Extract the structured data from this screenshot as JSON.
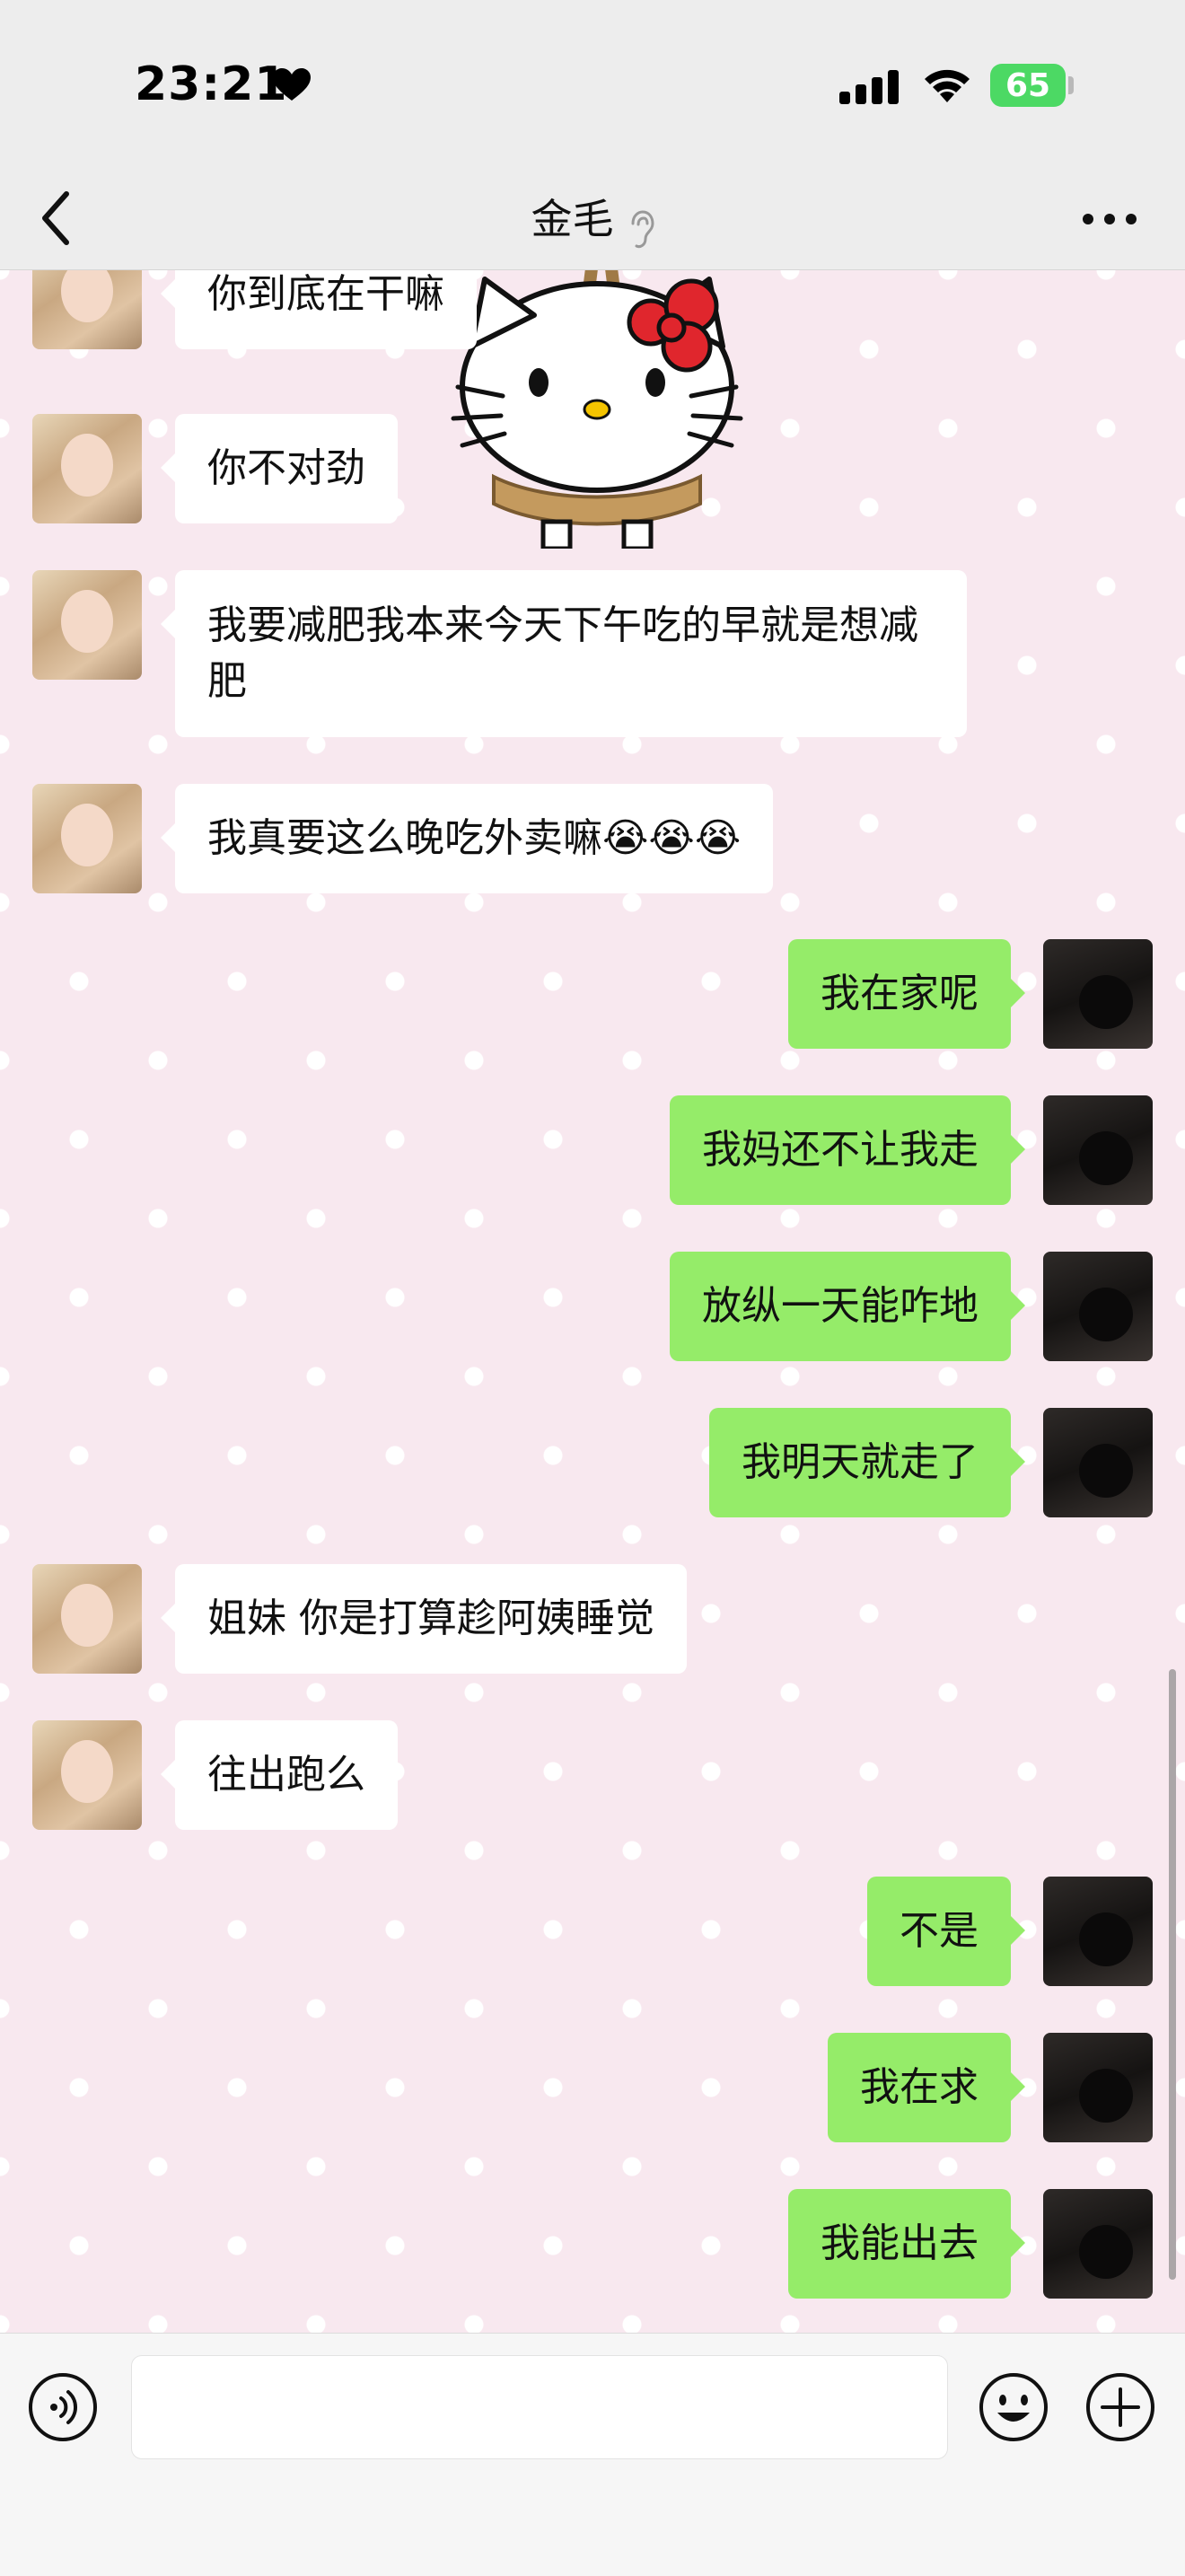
{
  "status_bar": {
    "time": "23:21",
    "battery": "65"
  },
  "header": {
    "title": "金毛"
  },
  "messages": [
    {
      "side": "left",
      "text": "你到底在干嘛"
    },
    {
      "side": "left",
      "text": "你不对劲"
    },
    {
      "side": "left",
      "text": "我要减肥我本来今天下午吃的早就是想减肥"
    },
    {
      "side": "left",
      "text": "我真要这么晚吃外卖嘛😭😭😭"
    },
    {
      "side": "right",
      "text": "我在家呢"
    },
    {
      "side": "right",
      "text": "我妈还不让我走"
    },
    {
      "side": "right",
      "text": "放纵一天能咋地"
    },
    {
      "side": "right",
      "text": "我明天就走了"
    },
    {
      "side": "left",
      "text": "姐妹 你是打算趁阿姨睡觉"
    },
    {
      "side": "left",
      "text": "往出跑么"
    },
    {
      "side": "right",
      "text": "不是"
    },
    {
      "side": "right",
      "text": "我在求"
    },
    {
      "side": "right",
      "text": "我能出去"
    }
  ],
  "icons": {
    "back": "chevron-left-icon",
    "more": "more-dots-icon",
    "voice": "voice-input-icon",
    "emoji": "emoji-icon",
    "add": "plus-icon"
  },
  "colors": {
    "incoming_bubble": "#ffffff",
    "outgoing_bubble": "#95ec69",
    "bar_bg": "#ededed"
  }
}
